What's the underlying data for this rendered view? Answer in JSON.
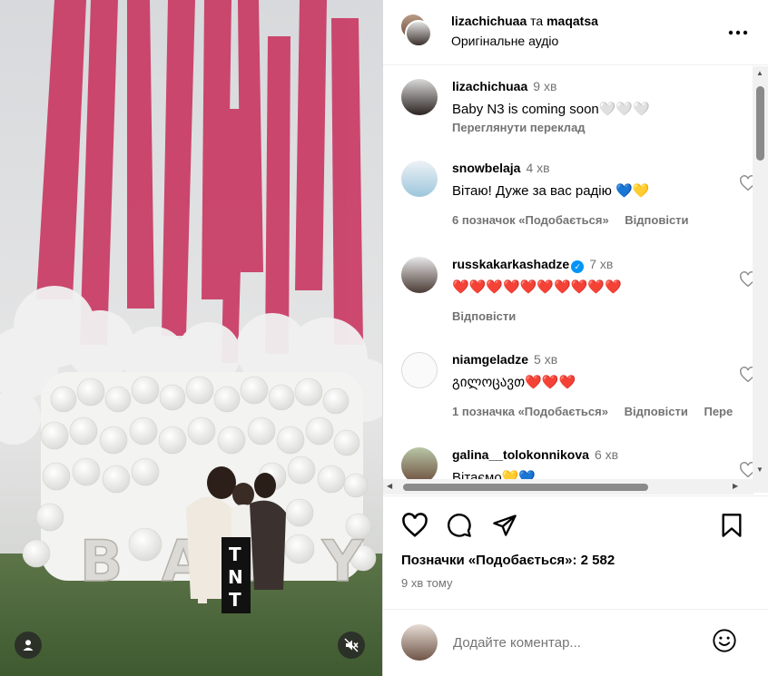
{
  "header": {
    "user1": "lizachichuaa",
    "conjunction": "та",
    "user2": "maqatsa",
    "audio": "Оригінальне аудіо"
  },
  "media": {
    "letters": [
      "B",
      "A",
      "B",
      "Y"
    ],
    "box_text": "TNT"
  },
  "caption": {
    "username": "lizachichuaa",
    "time": "9 хв",
    "text": "Baby N3 is coming soon🤍🤍🤍",
    "translate": "Переглянути переклад"
  },
  "comments": [
    {
      "username": "snowbelaja",
      "time": "4 хв",
      "text": "Вітаю! Дуже за вас радію 💙💛",
      "likes": "6 позначок «Подобається»",
      "reply": "Відповісти"
    },
    {
      "username": "russkakarkashadze",
      "time": "7 хв",
      "text": "❤️❤️❤️❤️❤️❤️❤️❤️❤️❤️",
      "reply": "Відповісти",
      "verified": true
    },
    {
      "username": "niamgeladze",
      "time": "5 хв",
      "text": "გილოცავთ❤️❤️❤️",
      "likes": "1 позначка «Подобається»",
      "reply": "Відповісти",
      "extra": "Пере"
    },
    {
      "username": "galina__tolokonnikova",
      "time": "6 хв",
      "text": "Вітаємо💛💙"
    }
  ],
  "footer": {
    "likes": "Позначки «Подобається»: 2 582",
    "time_ago": "9 хв тому",
    "comment_placeholder": "Додайте коментар..."
  },
  "colors": {
    "accent": "#0095f6",
    "muted": "#737373",
    "heart": "#e0245e",
    "smoke_pink": "#c8325e"
  }
}
